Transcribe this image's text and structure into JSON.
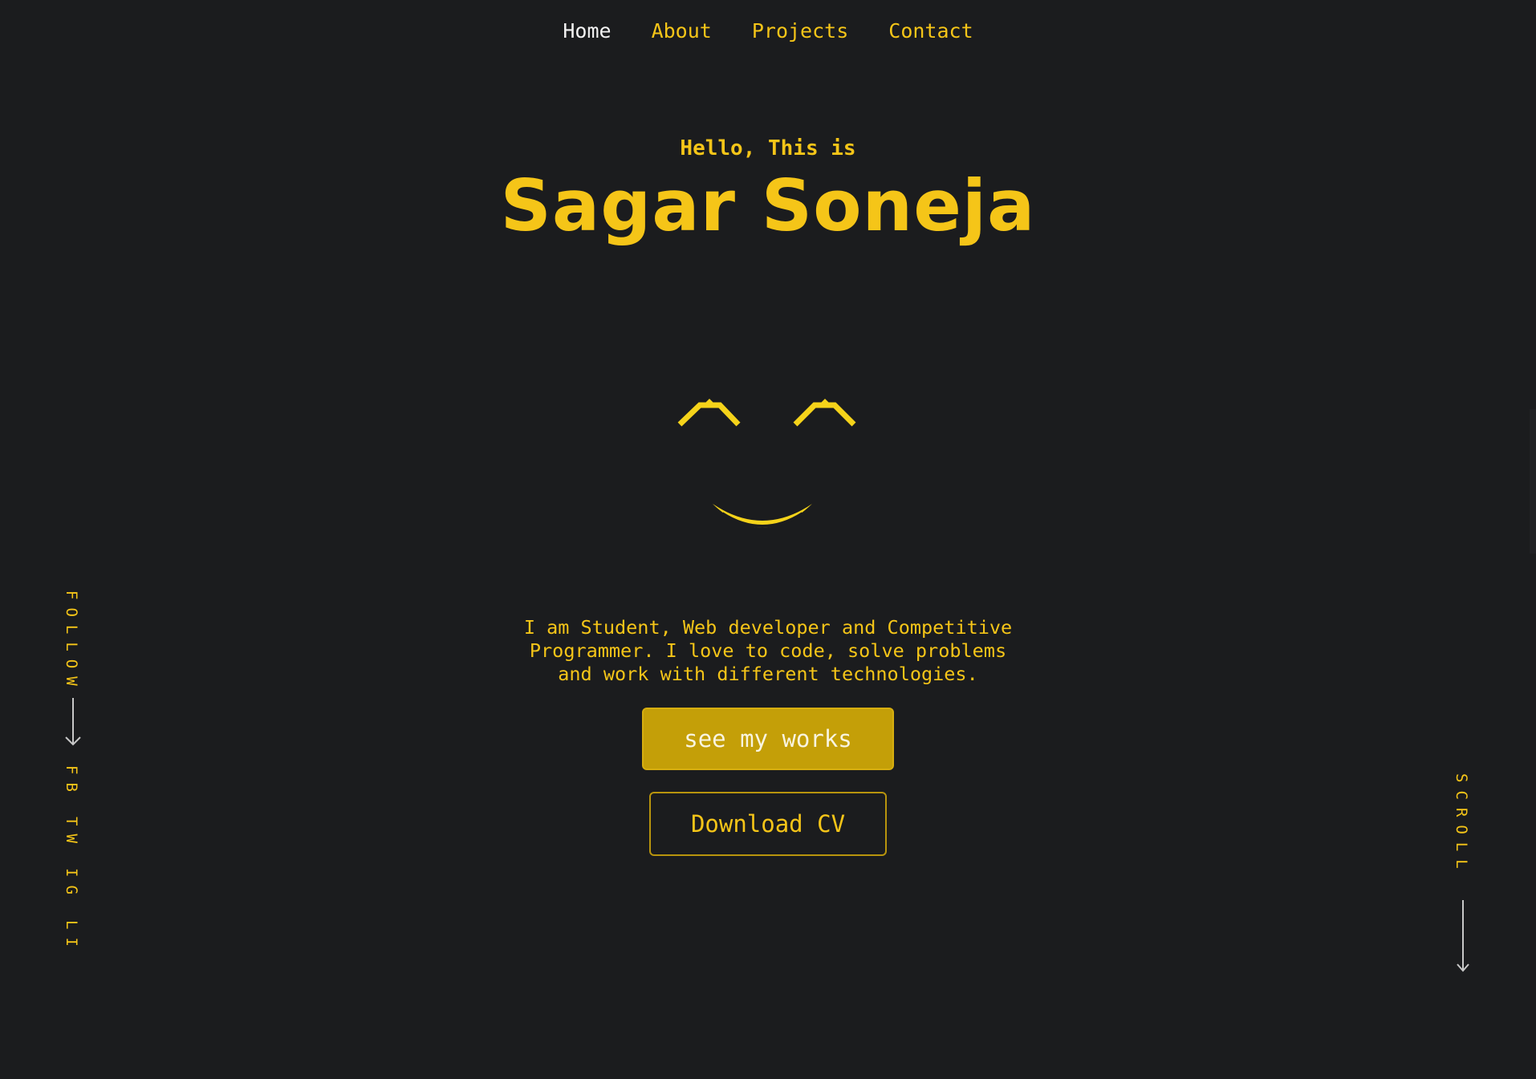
{
  "nav": {
    "items": [
      {
        "label": "Home",
        "active": true
      },
      {
        "label": "About",
        "active": false
      },
      {
        "label": "Projects",
        "active": false
      },
      {
        "label": "Contact",
        "active": false
      }
    ]
  },
  "hero": {
    "greeting": "Hello, This is",
    "name": "Sagar Soneja",
    "description": "I am Student, Web developer and Competitive Programmer. I love to code, solve problems and work with different technologies."
  },
  "buttons": {
    "primary": "see my works",
    "secondary": "Download CV"
  },
  "follow": {
    "label": "FOLLOW",
    "links": [
      "FB",
      "TW",
      "IG",
      "LI"
    ]
  },
  "scroll": {
    "label": "SCROLL"
  },
  "colors": {
    "background": "#1b1c1e",
    "accent": "#f5c518",
    "button_fill": "#c49f08",
    "active_nav": "#f2f2f2"
  },
  "icons": {
    "face": "smiley-face-icon",
    "arrow": "arrow-down-icon"
  }
}
